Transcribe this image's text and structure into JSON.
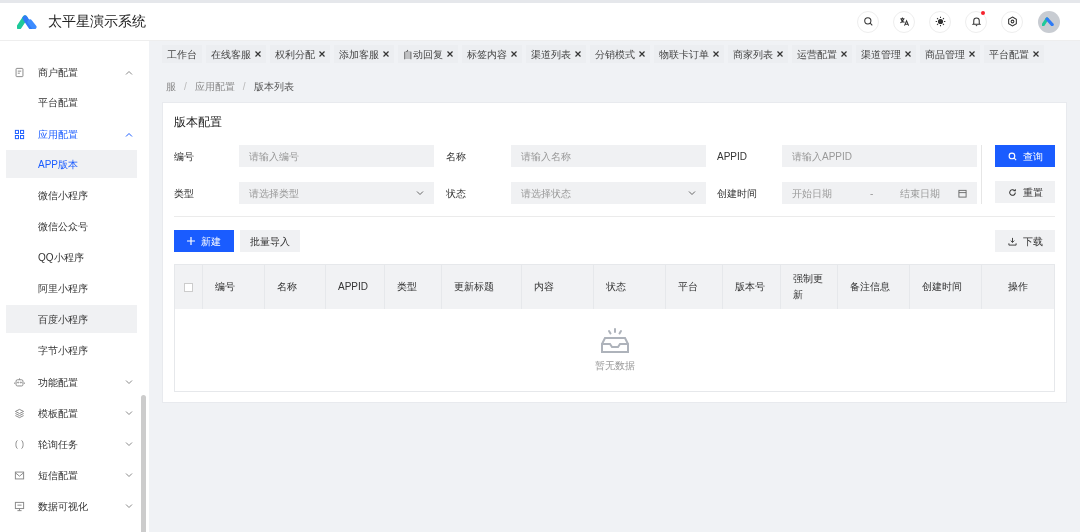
{
  "app": {
    "title": "太平星演示系统"
  },
  "header_actions": [
    {
      "kind": "search"
    },
    {
      "kind": "translate"
    },
    {
      "kind": "theme"
    },
    {
      "kind": "bell",
      "badge": true
    },
    {
      "kind": "settings"
    }
  ],
  "sidebar": {
    "items": [
      {
        "label": "商户配置",
        "expanded": true,
        "selected": false,
        "children": [
          {
            "label": "平台配置",
            "selected": false,
            "hovered": false
          }
        ]
      },
      {
        "label": "应用配置",
        "expanded": true,
        "selected": true,
        "children": [
          {
            "label": "APP版本",
            "selected": true,
            "hovered": false
          },
          {
            "label": "微信小程序",
            "selected": false,
            "hovered": false
          },
          {
            "label": "微信公众号",
            "selected": false,
            "hovered": false
          },
          {
            "label": "QQ小程序",
            "selected": false,
            "hovered": false
          },
          {
            "label": "阿里小程序",
            "selected": false,
            "hovered": false
          },
          {
            "label": "百度小程序",
            "selected": false,
            "hovered": true
          },
          {
            "label": "字节小程序",
            "selected": false,
            "hovered": false
          }
        ]
      },
      {
        "label": "功能配置",
        "expanded": false,
        "selected": false
      },
      {
        "label": "模板配置",
        "expanded": false,
        "selected": false
      },
      {
        "label": "轮询任务",
        "expanded": false,
        "selected": false
      },
      {
        "label": "短信配置",
        "expanded": false,
        "selected": false
      },
      {
        "label": "数据可视化",
        "expanded": false,
        "selected": false
      }
    ]
  },
  "tabs": [
    {
      "label": "工作台",
      "closable": false
    },
    {
      "label": "在线客服",
      "closable": true
    },
    {
      "label": "权利分配",
      "closable": true
    },
    {
      "label": "添加客服",
      "closable": true
    },
    {
      "label": "自动回复",
      "closable": true
    },
    {
      "label": "标签内容",
      "closable": true
    },
    {
      "label": "渠道列表",
      "closable": true
    },
    {
      "label": "分销模式",
      "closable": true
    },
    {
      "label": "物联卡订单",
      "closable": true
    },
    {
      "label": "商家列表",
      "closable": true
    },
    {
      "label": "运营配置",
      "closable": true
    },
    {
      "label": "渠道管理",
      "closable": true
    },
    {
      "label": "商品管理",
      "closable": true
    },
    {
      "label": "平台配置",
      "closable": true
    }
  ],
  "breadcrumb": {
    "separator": "/",
    "items": [
      "服",
      "应用配置",
      "版本列表"
    ]
  },
  "card": {
    "title": "版本配置",
    "filters": [
      {
        "label": "编号",
        "kind": "input",
        "placeholder": "请输入编号"
      },
      {
        "label": "名称",
        "kind": "input",
        "placeholder": "请输入名称"
      },
      {
        "label": "APPID",
        "kind": "input",
        "placeholder": "请输入APPID"
      },
      {
        "label": "类型",
        "kind": "select",
        "placeholder": "请选择类型"
      },
      {
        "label": "状态",
        "kind": "select",
        "placeholder": "请选择状态"
      },
      {
        "label": "创建时间",
        "kind": "daterange",
        "start_placeholder": "开始日期",
        "separator": "-",
        "end_placeholder": "结束日期"
      }
    ],
    "query_button": "查询",
    "reset_button": "重置",
    "new_button": "新建",
    "import_button": "批量导入",
    "download_button": "下载",
    "table": {
      "columns": [
        "编号",
        "名称",
        "APPID",
        "类型",
        "更新标题",
        "内容",
        "状态",
        "平台",
        "版本号",
        "强制更新",
        "备注信息",
        "创建时间",
        "操作"
      ],
      "select_all_checked": false,
      "empty_text": "暂无数据"
    }
  }
}
